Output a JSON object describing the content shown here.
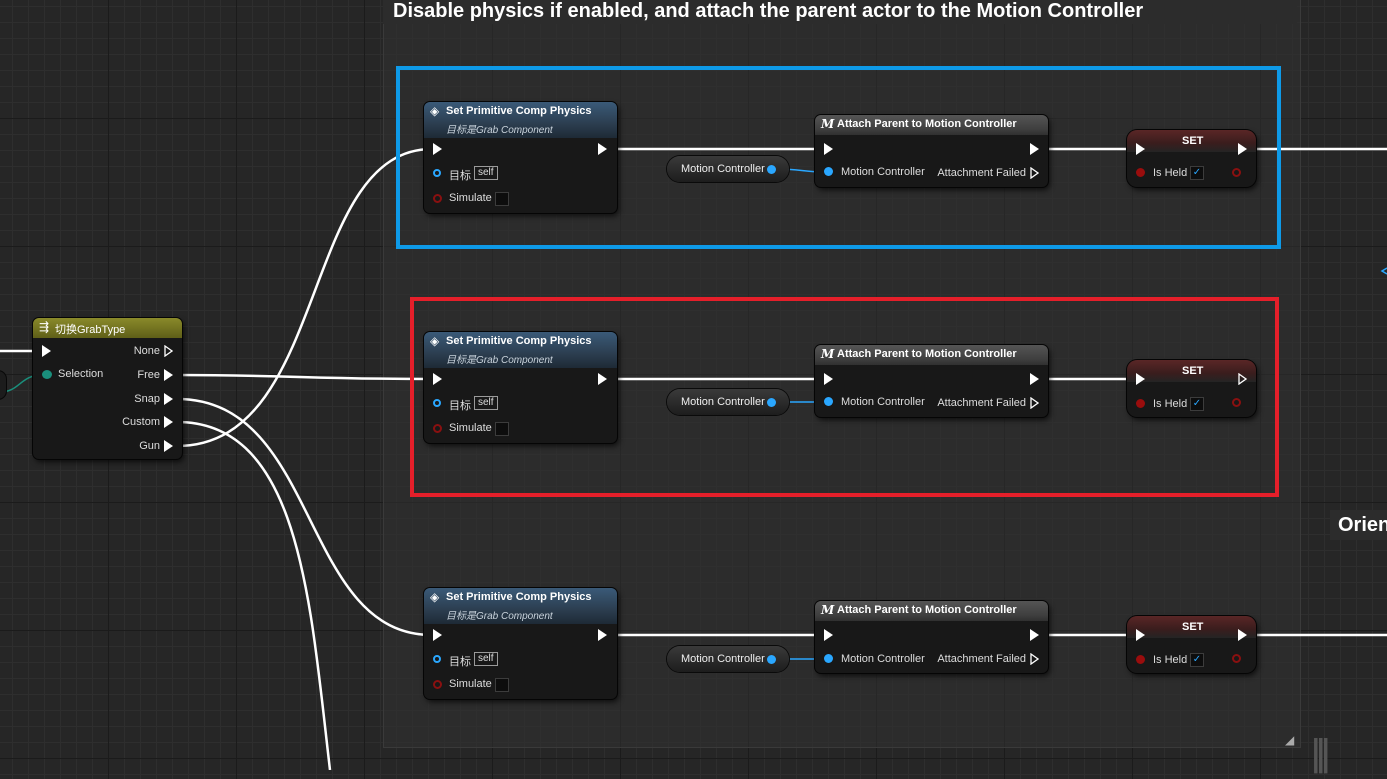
{
  "comment": {
    "title": "Disable physics if enabled, and attach the parent actor to the Motion Controller"
  },
  "switch_node": {
    "title": "切换GrabType",
    "selection_label": "Selection",
    "outputs": [
      "None",
      "Free",
      "Snap",
      "Custom",
      "Gun"
    ]
  },
  "set_physics": {
    "title": "Set Primitive Comp Physics",
    "subtitle": "目标是Grab Component",
    "target_label": "目标",
    "self_label": "self",
    "simulate_label": "Simulate"
  },
  "motion_var": {
    "label": "Motion Controller"
  },
  "attach_node": {
    "title": "Attach Parent to Motion Controller",
    "input_label": "Motion Controller",
    "output_label": "Attachment Failed"
  },
  "set_node": {
    "title": "SET",
    "var_label": "Is Held",
    "checked": true
  },
  "offscreen_comment": {
    "title_fragment": "Orient"
  },
  "icons": {
    "function": "function-icon",
    "macro": "macro-icon",
    "switch": "switch-icon"
  },
  "colors": {
    "exec": "#ffffff",
    "object_pin": "#2aa7ff",
    "bool_pin": "#9a0d0d",
    "byte_pin": "#1a8f7c",
    "highlight_blue": "#0e9ae8",
    "highlight_red": "#e51f2a"
  }
}
